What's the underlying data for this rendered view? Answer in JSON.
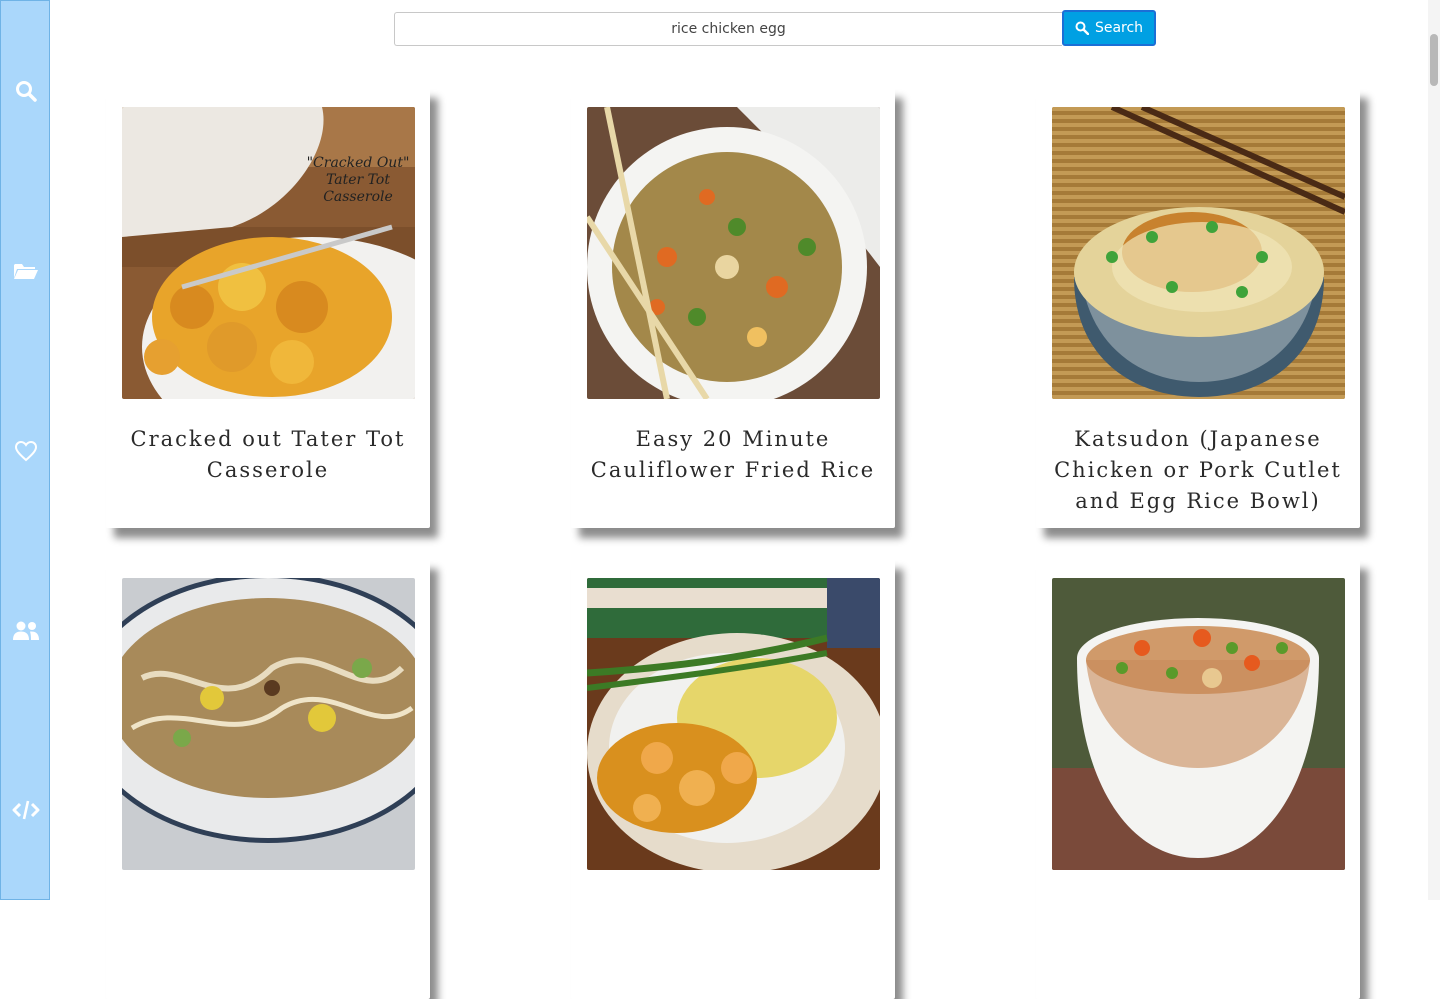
{
  "search": {
    "query": "rice chicken egg",
    "button_label": "Search"
  },
  "sidebar": {
    "items": [
      {
        "icon": "search-icon"
      },
      {
        "icon": "folder-open-icon"
      },
      {
        "icon": "heart-icon"
      },
      {
        "icon": "users-icon"
      },
      {
        "icon": "code-icon"
      }
    ]
  },
  "recipes": [
    {
      "title": "Cracked out Tater Tot Casserole",
      "overlay_text": "\"Cracked Out\" Tater Tot Casserole"
    },
    {
      "title": "Easy 20 Minute Cauliflower Fried Rice"
    },
    {
      "title": "Katsudon (Japanese Chicken or Pork Cutlet and Egg Rice Bowl)"
    },
    {
      "title": ""
    },
    {
      "title": ""
    },
    {
      "title": ""
    }
  ],
  "colors": {
    "sidebar_bg": "#aad7fb",
    "accent": "#00a0e3"
  }
}
